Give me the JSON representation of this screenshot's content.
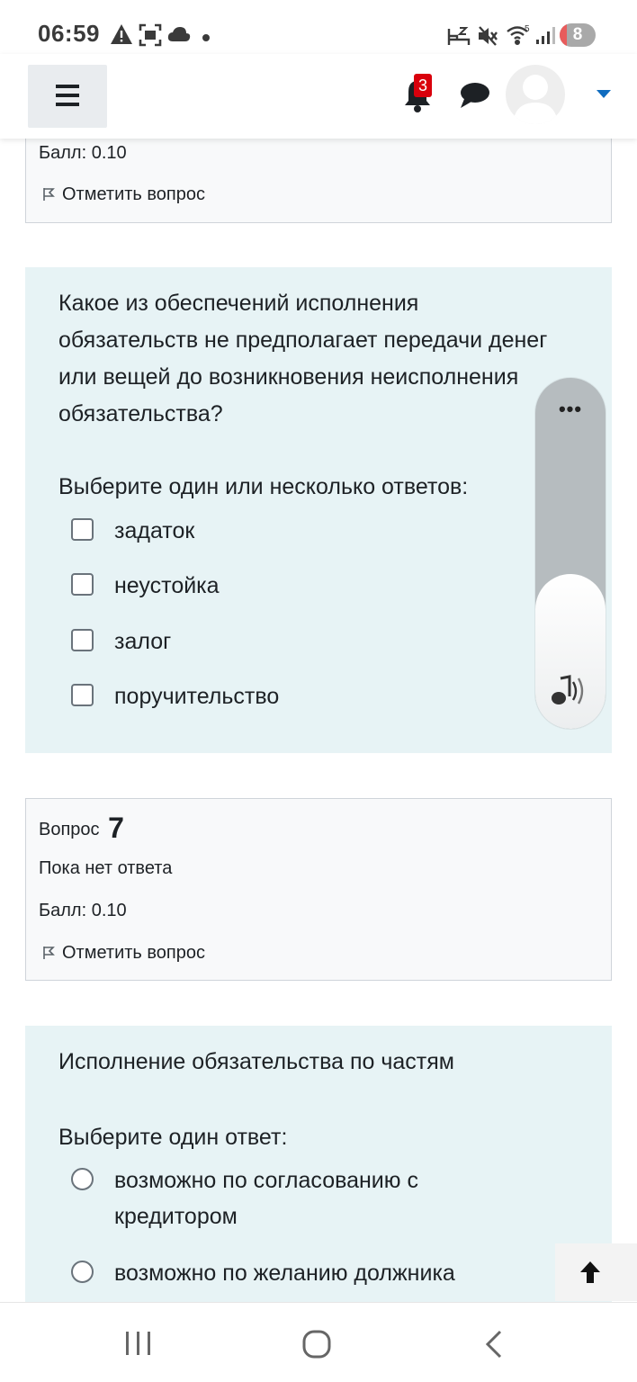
{
  "status_bar": {
    "time": "06:59",
    "battery": "8",
    "left_icons": [
      "warning-icon",
      "screenshot-icon",
      "cloud-icon",
      "dot-icon"
    ],
    "right_icons": [
      "sleep-icon",
      "mute-icon",
      "wifi-icon",
      "signal-icon",
      "battery-icon"
    ]
  },
  "navbar": {
    "notification_count": "3",
    "icons": [
      "hamburger-menu-icon",
      "bell-icon",
      "chat-icon",
      "avatar",
      "caret-down-icon"
    ]
  },
  "prev_question": {
    "grade": "Балл: 0.10",
    "flag_label": "Отметить вопрос"
  },
  "question6": {
    "text": "Какое из обеспечений исполнения обязательств не предполагает передачи денег или вещей до возникновения неисполнения обязательства?",
    "prompt": "Выберите один или несколько ответов:",
    "options": [
      "задаток",
      "неустойка",
      "залог",
      "поручительство"
    ]
  },
  "question7": {
    "label": "Вопрос",
    "number": "7",
    "status": "Пока нет ответа",
    "grade": "Балл: 0.10",
    "flag_label": "Отметить вопрос",
    "text": "Исполнение обязательства по частям",
    "prompt": "Выберите один ответ:",
    "options": [
      "возможно по согласованию с кредитором",
      "возможно по желанию должника"
    ]
  },
  "volume_overlay": {
    "more": "•••",
    "level": 0.44
  },
  "colors": {
    "question_bg": "#e7f3f5",
    "info_bg": "#f8f9fa",
    "badge": "#d9000c",
    "accent": "#0f6cbf"
  }
}
